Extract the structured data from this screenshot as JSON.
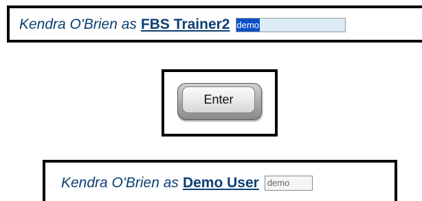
{
  "top_panel": {
    "lead_text": "Kendra O'Brien as",
    "role_link": "FBS Trainer2",
    "input_value": "demo"
  },
  "enter_button": {
    "label": "Enter"
  },
  "bottom_panel": {
    "lead_text": "Kendra O'Brien as",
    "role_link": "Demo User",
    "input_value": "demo"
  },
  "colors": {
    "text": "#0b3f73",
    "selection": "#0a50c8",
    "selected_field_bg": "#dcecf8",
    "border": "#000000"
  }
}
